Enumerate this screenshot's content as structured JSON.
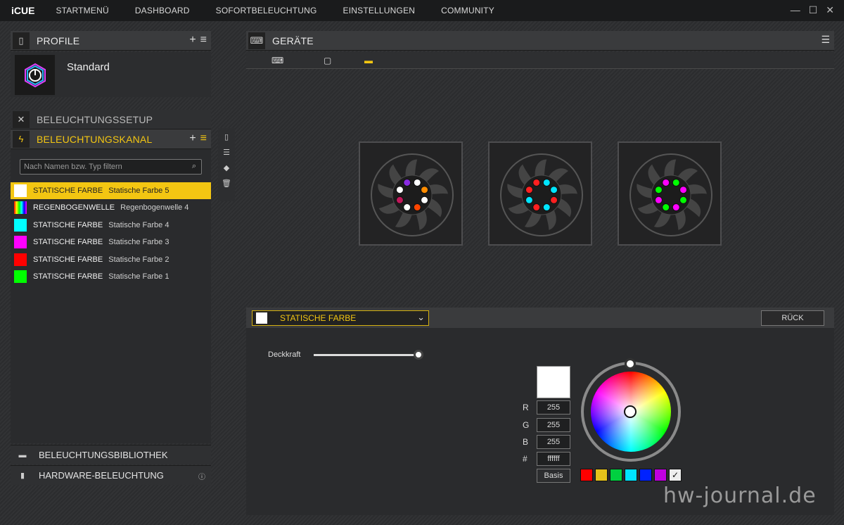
{
  "app": {
    "logo": "iCUE"
  },
  "nav": [
    "STARTMENÜ",
    "DASHBOARD",
    "SOFORTBELEUCHTUNG",
    "EINSTELLUNGEN",
    "COMMUNITY"
  ],
  "window_controls": {
    "minimize": "—",
    "maximize": "☐",
    "close": "✕"
  },
  "profile": {
    "title": "PROFILE",
    "name": "Standard"
  },
  "setup": {
    "title": "BELEUCHTUNGSSETUP"
  },
  "channel": {
    "title": "BELEUCHTUNGSKANAL",
    "search_placeholder": "Nach Namen bzw. Typ filtern",
    "items": [
      {
        "type": "STATISCHE FARBE",
        "name": "Statische Farbe 5",
        "color": "#ffffff",
        "selected": true
      },
      {
        "type": "REGENBOGENWELLE",
        "name": "Regenbogenwelle 4",
        "color": "rainbow"
      },
      {
        "type": "STATISCHE FARBE",
        "name": "Statische Farbe 4",
        "color": "#00ffff"
      },
      {
        "type": "STATISCHE FARBE",
        "name": "Statische Farbe 3",
        "color": "#ff00ff"
      },
      {
        "type": "STATISCHE FARBE",
        "name": "Statische Farbe 2",
        "color": "#ff0000"
      },
      {
        "type": "STATISCHE FARBE",
        "name": "Statische Farbe 1",
        "color": "#00ff00"
      }
    ]
  },
  "library": {
    "title": "BELEUCHTUNGSBIBLIOTHEK"
  },
  "hardware": {
    "title": "HARDWARE-BELEUCHTUNG"
  },
  "devices": {
    "title": "GERÄTE"
  },
  "fans": [
    {
      "leds": [
        "#8a2be2",
        "#ffffff",
        "#ff8c00",
        "#ffffff",
        "#ff4500",
        "#ffffff",
        "#c2185b",
        "#ffffff"
      ]
    },
    {
      "leds": [
        "#ff2020",
        "#00e5ff",
        "#00e5ff",
        "#ff2020",
        "#00e5ff",
        "#ff2020",
        "#00e5ff",
        "#ff2020"
      ]
    },
    {
      "leds": [
        "#ff00ff",
        "#00ff00",
        "#ff00ff",
        "#00ff00",
        "#ff00ff",
        "#00ff00",
        "#ff00ff",
        "#00ff00"
      ]
    }
  ],
  "effect": {
    "label": "STATISCHE FARBE",
    "back": "RÜCK",
    "opacity_label": "Deckkraft",
    "opacity": 1.0
  },
  "color": {
    "r_label": "R",
    "g_label": "G",
    "b_label": "B",
    "hex_label": "#",
    "r": "255",
    "g": "255",
    "b": "255",
    "hex": "ffffff",
    "basis": "Basis",
    "presets": [
      "#ff0000",
      "#e6c21a",
      "#00d040",
      "#00e5ff",
      "#0022ff",
      "#c000e0",
      "#eeeeee"
    ]
  },
  "watermark": "hw-journal.de",
  "accent": "#f3c612"
}
